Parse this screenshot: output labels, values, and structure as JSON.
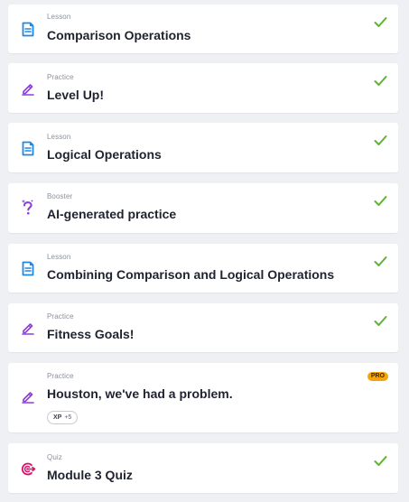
{
  "colors": {
    "background": "#eef0f4",
    "card": "#ffffff",
    "check": "#5fb335",
    "lesson_icon": "#1e88e5",
    "practice_icon": "#8b3fd9",
    "quiz_icon": "#d9156a",
    "pro_badge": "#f3a50c"
  },
  "items": [
    {
      "kind": "Lesson",
      "title": "Comparison Operations",
      "icon": "document-icon",
      "completed": true
    },
    {
      "kind": "Practice",
      "title": "Level Up!",
      "icon": "pencil-icon",
      "completed": true
    },
    {
      "kind": "Lesson",
      "title": "Logical Operations",
      "icon": "document-icon",
      "completed": true
    },
    {
      "kind": "Booster",
      "title": "AI-generated practice",
      "icon": "question-sparkle-icon",
      "completed": true
    },
    {
      "kind": "Lesson",
      "title": "Combining Comparison and Logical Operations",
      "icon": "document-icon",
      "completed": true
    },
    {
      "kind": "Practice",
      "title": "Fitness Goals!",
      "icon": "pencil-icon",
      "completed": true
    },
    {
      "kind": "Practice",
      "title": "Houston, we've had a problem.",
      "icon": "pencil-icon",
      "completed": false,
      "badge": "PRO",
      "xp_label": "XP",
      "xp_value": "+5"
    },
    {
      "kind": "Quiz",
      "title": "Module 3 Quiz",
      "icon": "target-icon",
      "completed": true
    }
  ]
}
